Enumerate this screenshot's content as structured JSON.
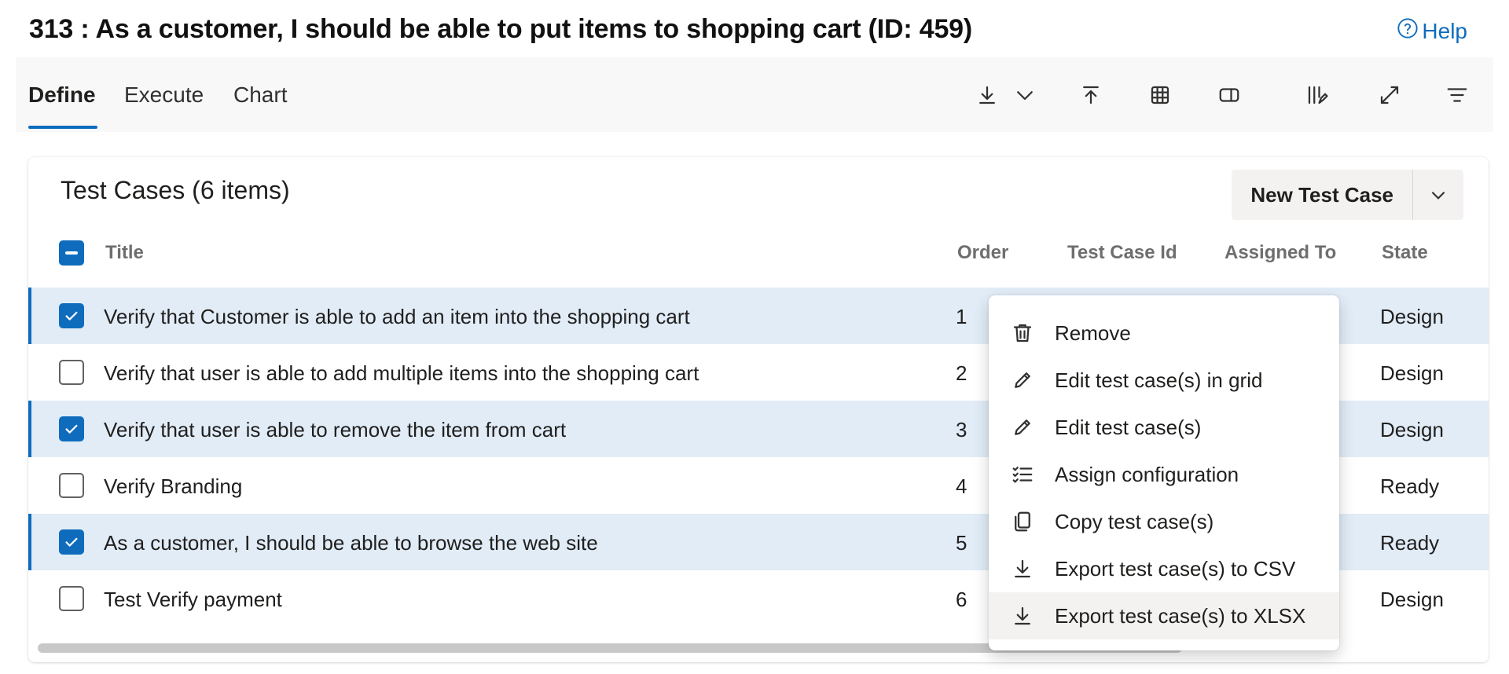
{
  "page": {
    "title": "313 : As a customer, I should be able to put items to shopping cart (ID: 459)",
    "help_label": "Help"
  },
  "tabs": [
    {
      "label": "Define",
      "active": true
    },
    {
      "label": "Execute",
      "active": false
    },
    {
      "label": "Chart",
      "active": false
    }
  ],
  "toolbar": {
    "icons": [
      "download-icon",
      "chevron-down-icon",
      "upload-icon",
      "grid-icon",
      "side-pane-icon",
      "column-options-icon",
      "fullscreen-icon",
      "filter-icon"
    ]
  },
  "card": {
    "title": "Test Cases (6 items)",
    "new_button_label": "New Test Case"
  },
  "columns": {
    "title": "Title",
    "order": "Order",
    "test_case_id": "Test Case Id",
    "assigned_to": "Assigned To",
    "state": "State"
  },
  "rows": [
    {
      "title": "Verify that Customer is able to add an item into the shopping cart",
      "order": "1",
      "state": "Design",
      "selected": true
    },
    {
      "title": "Verify that user is able to add multiple items into the shopping cart",
      "order": "2",
      "state": "Design",
      "selected": false
    },
    {
      "title": "Verify that user is able to remove the item from cart",
      "order": "3",
      "state": "Design",
      "selected": true
    },
    {
      "title": "Verify Branding",
      "order": "4",
      "state": "Ready",
      "selected": false
    },
    {
      "title": "As a customer, I should be able to browse the web site",
      "order": "5",
      "state": "Ready",
      "selected": true
    },
    {
      "title": "Test Verify payment",
      "order": "6",
      "state": "Design",
      "selected": false
    }
  ],
  "context_menu": {
    "items": [
      {
        "label": "Remove",
        "icon": "trash-icon"
      },
      {
        "label": "Edit test case(s) in grid",
        "icon": "pencil-icon"
      },
      {
        "label": "Edit test case(s)",
        "icon": "pencil-icon"
      },
      {
        "label": "Assign configuration",
        "icon": "checklist-icon"
      },
      {
        "label": "Copy test case(s)",
        "icon": "copy-icon"
      },
      {
        "label": "Export test case(s) to CSV",
        "icon": "download-icon"
      },
      {
        "label": "Export test case(s) to XLSX",
        "icon": "download-icon"
      }
    ]
  },
  "colors": {
    "accent": "#0f6cbd",
    "selected_row": "#e1ecf7"
  }
}
